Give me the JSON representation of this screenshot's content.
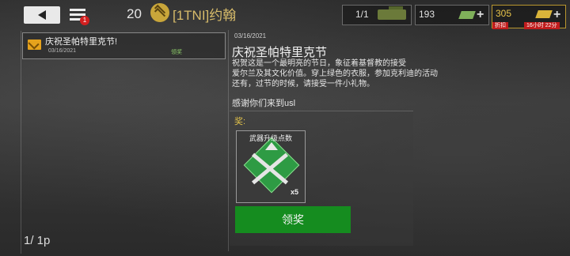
{
  "top_bar": {
    "menu_badge": "1",
    "level": "20",
    "player_name": "[1TNI]约翰",
    "tanks": "1/1",
    "cash": "193",
    "gold": "305",
    "discount_label": "折扣",
    "timer": "16小时 22分"
  },
  "mail_list": {
    "items": [
      {
        "title": "庆祝圣帕特里克节!",
        "date": "03/16/2021",
        "status": "领奖"
      }
    ],
    "page_indicator": "1/ 1p"
  },
  "detail": {
    "date": "03/16/2021",
    "title": "庆祝圣帕特里克节",
    "body": "祝贺这是一个最明亮的节日，象征着基督教的接受\n爱尔兰及其文化价值。穿上绿色的衣服，参加克利迪的活动\n还有，过节的时候，请接受一件小礼物。",
    "thanks": "感谢你们来到usl",
    "reward_label": "奖:",
    "reward": {
      "title": "武器升级点数",
      "quantity": "x5"
    },
    "claim_label": "领奖"
  },
  "colors": {
    "claim_button": "#158c1f",
    "gold_text": "#d7bb6a",
    "badge_red": "#d21f1f"
  }
}
